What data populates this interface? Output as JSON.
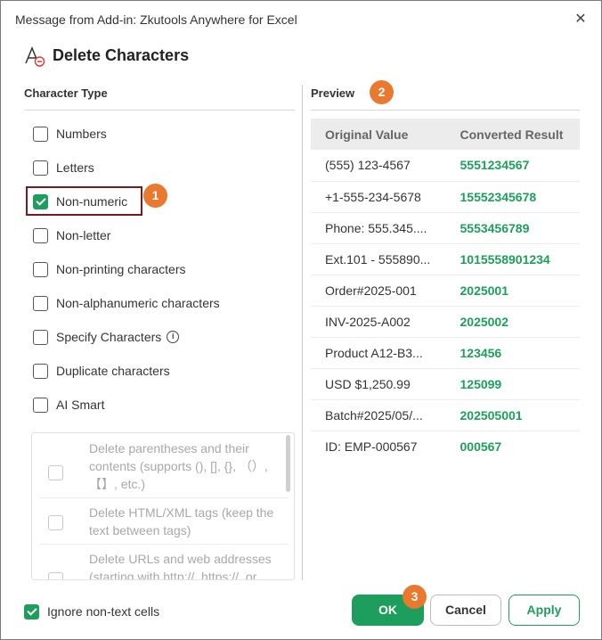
{
  "window": {
    "title": "Message from Add-in: Zkutools Anywhere for Excel",
    "close_icon": "close-icon"
  },
  "header": {
    "title": "Delete Characters",
    "icon": "delete-characters-icon"
  },
  "character_type": {
    "title": "Character Type",
    "options": [
      {
        "label": "Numbers",
        "checked": false
      },
      {
        "label": "Letters",
        "checked": false
      },
      {
        "label": "Non-numeric",
        "checked": true
      },
      {
        "label": "Non-letter",
        "checked": false
      },
      {
        "label": "Non-printing characters",
        "checked": false
      },
      {
        "label": "Non-alphanumeric characters",
        "checked": false
      },
      {
        "label": "Specify Characters",
        "checked": false,
        "info_icon": "ⓘ"
      },
      {
        "label": "Duplicate characters",
        "checked": false
      },
      {
        "label": "AI Smart",
        "checked": false
      }
    ],
    "ai_options": [
      {
        "text": "Delete parentheses and their contents (supports (), [], {}, （）, 【】, etc.)",
        "checked": false
      },
      {
        "text": "Delete HTML/XML tags (keep the text between tags)",
        "checked": false
      },
      {
        "text": "Delete URLs and web addresses (starting with http://, https://, or",
        "checked": false
      }
    ]
  },
  "preview": {
    "title": "Preview",
    "columns": [
      "Original Value",
      "Converted Result"
    ],
    "rows": [
      [
        "(555) 123-4567",
        "5551234567"
      ],
      [
        "+1-555-234-5678",
        "15552345678"
      ],
      [
        "Phone: 555.345....",
        "5553456789"
      ],
      [
        "Ext.101 - 555890...",
        "1015558901234"
      ],
      [
        "Order#2025-001",
        "2025001"
      ],
      [
        "INV-2025-A002",
        "2025002"
      ],
      [
        "Product A12-B3...",
        "123456"
      ],
      [
        "USD $1,250.99",
        "125099"
      ],
      [
        "Batch#2025/05/...",
        "202505001"
      ],
      [
        "ID: EMP-000567",
        "000567"
      ]
    ]
  },
  "badges": {
    "one": "1",
    "two": "2",
    "three": "3"
  },
  "footer": {
    "ignore_label": "Ignore non-text cells",
    "ignore_checked": true,
    "ok_label": "OK",
    "cancel_label": "Cancel",
    "apply_label": "Apply"
  },
  "colors": {
    "accent": "#1e9e5c",
    "badge": "#e8792f",
    "highlight_border": "#7a1a1a"
  }
}
